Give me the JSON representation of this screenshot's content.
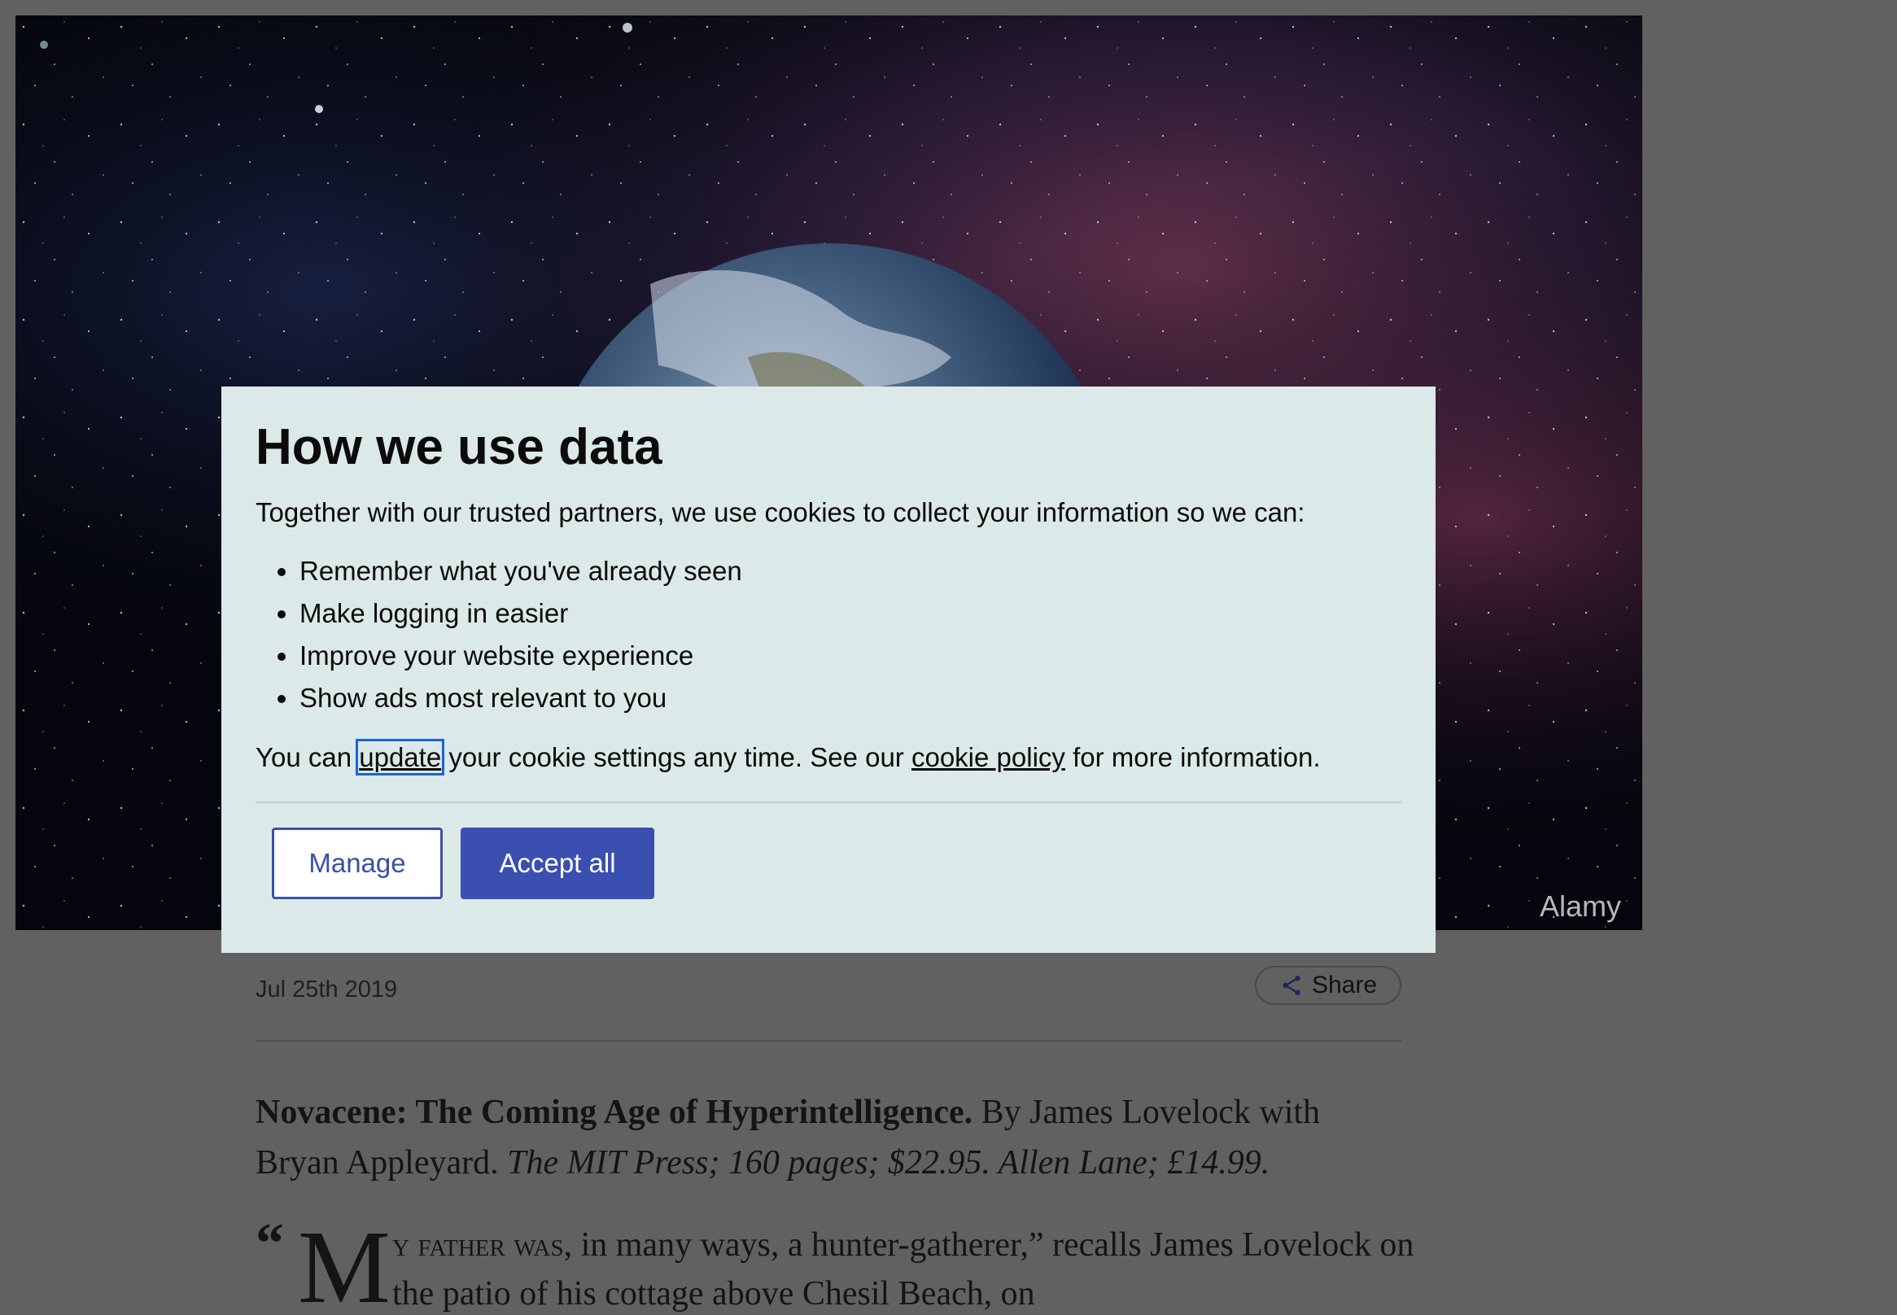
{
  "hero": {
    "photo_credit": "Alamy",
    "description_icon": "earth-in-space-image"
  },
  "article": {
    "date": "Jul 25th 2019",
    "share_label": "Share",
    "book_title": "Novacene: The Coming Age of Hyperintelligence.",
    "book_authors": "By James Lovelock with Bryan Appleyard.",
    "book_publishers": "The MIT Press; 160 pages; $22.95. Allen Lane; £14.99.",
    "lede_open_quote": "“",
    "lede_dropcap": "M",
    "lede_smallcaps": "Y FATHER WAS",
    "lede_text": ", in many ways, a hunter-gatherer,” recalls James Lovelock on the patio of his cottage above Chesil Beach, on"
  },
  "cookie_modal": {
    "title": "How we use data",
    "intro": "Together with our trusted partners, we use cookies to collect your information so we can:",
    "purposes": [
      "Remember what you've already seen",
      "Make logging in easier",
      "Improve your website experience",
      "Show ads most relevant to you"
    ],
    "note_prefix": "You can ",
    "note_update_link": "update",
    "note_middle": " your cookie settings any time. See our ",
    "note_policy_link": "cookie policy",
    "note_suffix": " for more information.",
    "manage_label": "Manage",
    "accept_label": "Accept all"
  },
  "colors": {
    "overlay": "#616161",
    "modal_background": "#dce9e9",
    "button_accent": "#3a4fb0",
    "focus_ring": "#1a64d6"
  }
}
